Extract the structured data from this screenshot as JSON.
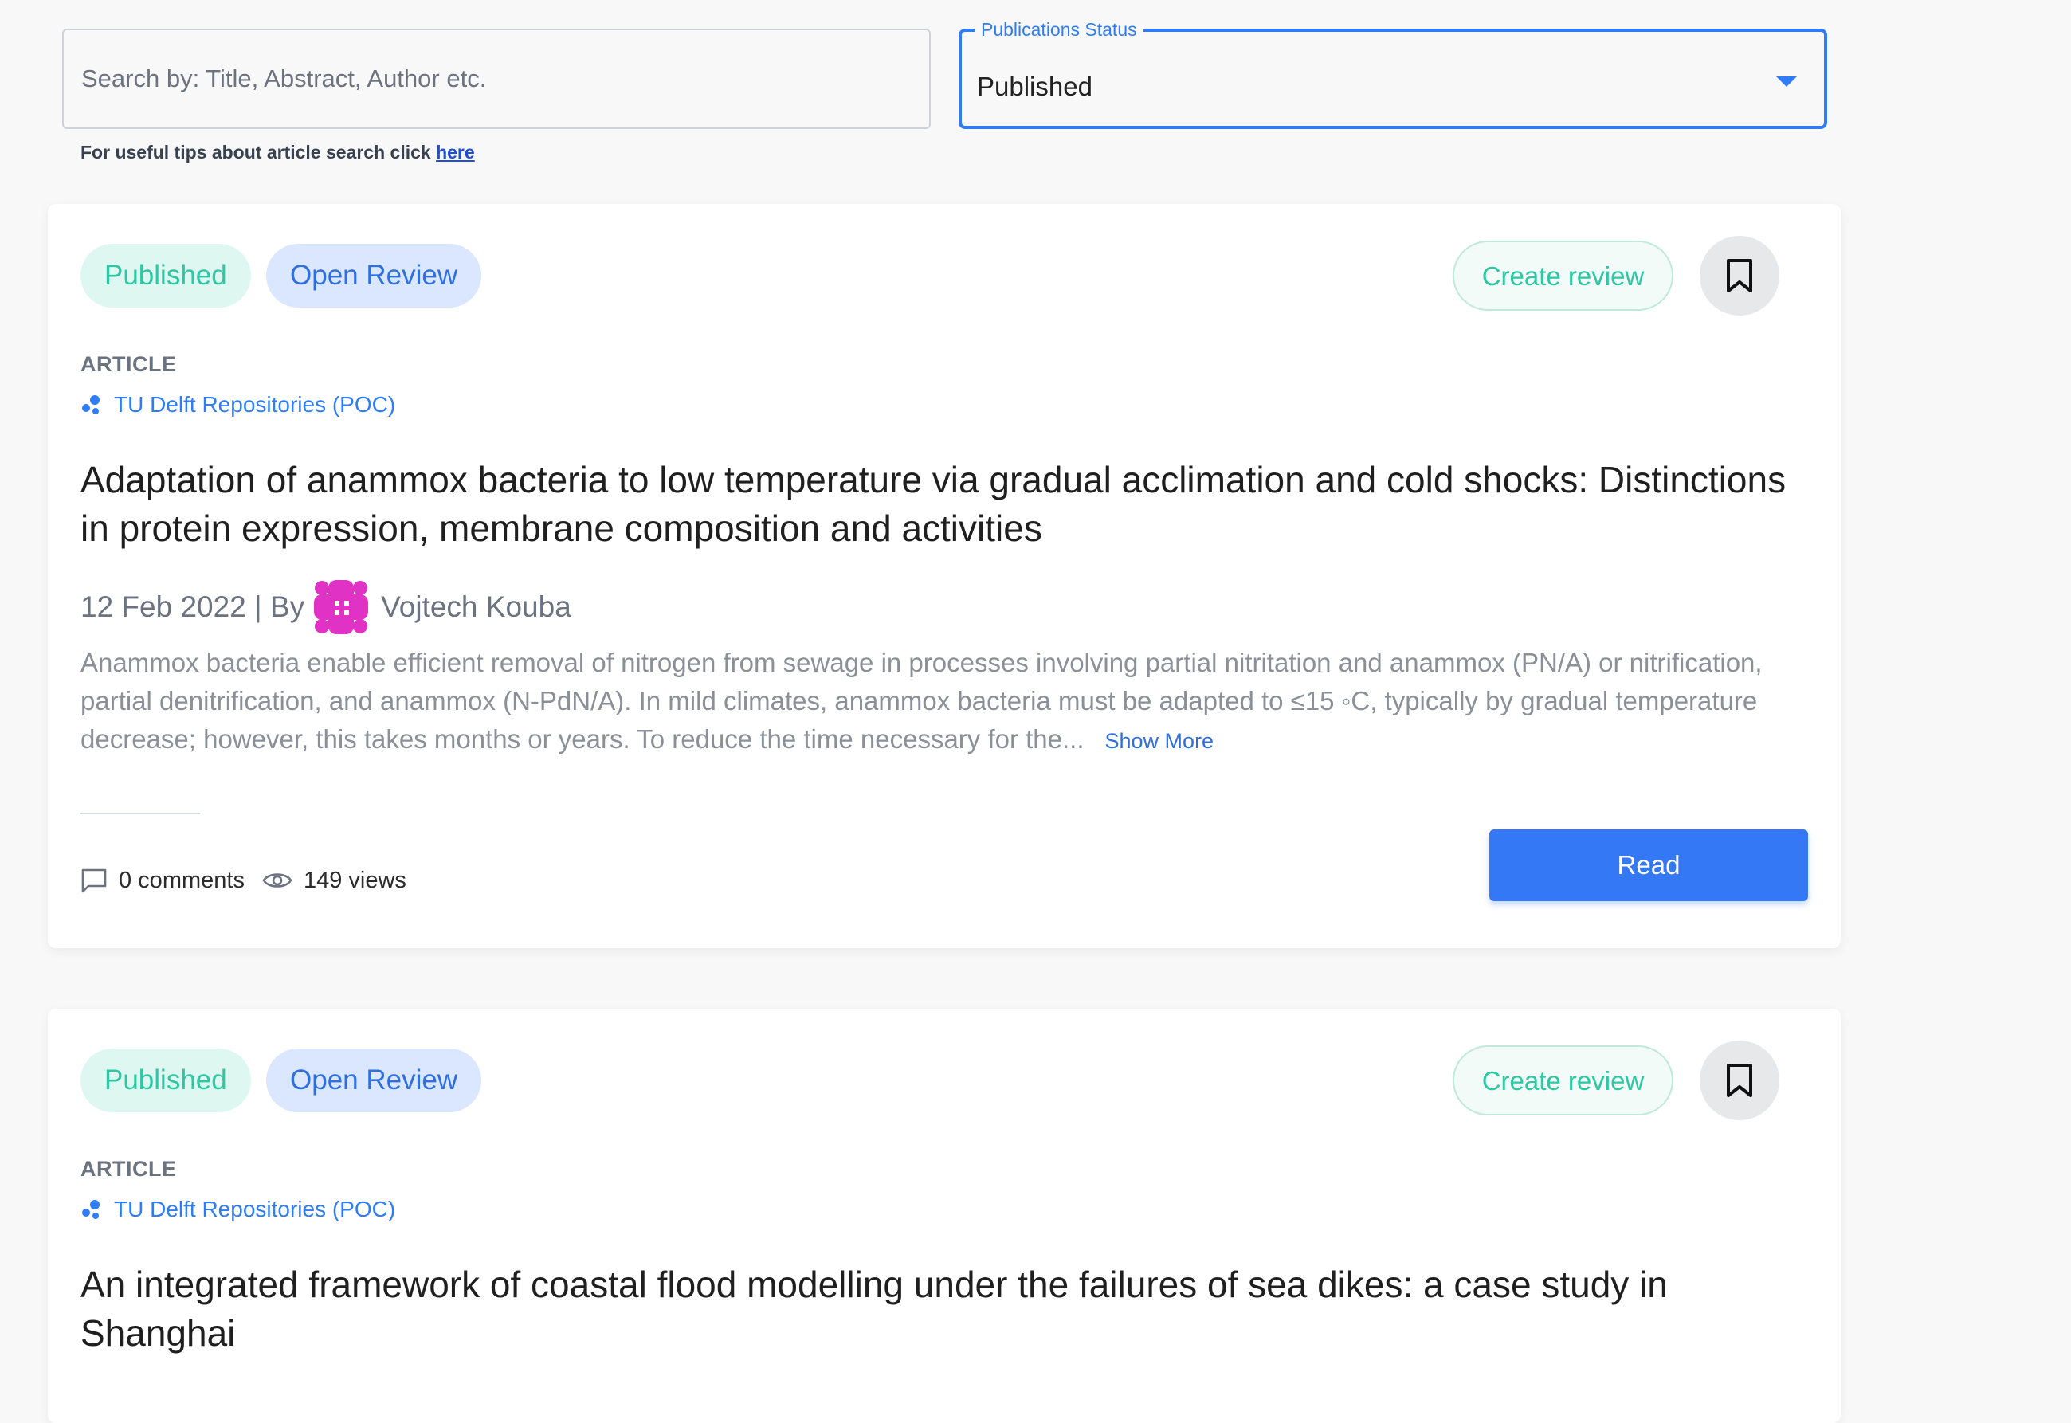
{
  "search": {
    "placeholder": "Search by: Title, Abstract, Author etc.",
    "tip_text": "For useful tips about article search click ",
    "tip_link": "here"
  },
  "status_filter": {
    "label": "Publications Status",
    "value": "Published"
  },
  "articles": [
    {
      "status_badge": "Published",
      "review_badge": "Open Review",
      "create_review_label": "Create review",
      "type": "ARTICLE",
      "source": "TU Delft Repositories (POC)",
      "title": "Adaptation of anammox bacteria to low temperature via gradual acclimation and cold shocks: Distinctions in protein expression, membrane composition and activities",
      "date_by": "12 Feb 2022 | By",
      "author": "Vojtech Kouba",
      "abstract": "Anammox bacteria enable efficient removal of nitrogen from sewage in processes involving partial nitritation and anammox (PN/A) or nitrification, partial denitrification, and anammox (N-PdN/A). In mild climates, anammox bacteria must be adapted to ≤15 ◦C, typically by gradual temperature decrease; however, this takes months or years. To reduce the time necessary for the...",
      "show_more": "Show More",
      "comments": "0 comments",
      "views": "149 views",
      "read_label": "Read"
    },
    {
      "status_badge": "Published",
      "review_badge": "Open Review",
      "create_review_label": "Create review",
      "type": "ARTICLE",
      "source": "TU Delft Repositories (POC)",
      "title": "An integrated framework of coastal flood modelling under the failures of sea dikes: a case study in Shanghai"
    }
  ],
  "colors": {
    "accent": "#3578f6",
    "published_text": "#2fc7a3",
    "published_bg": "#dff7f1",
    "open_review_text": "#2f6fde",
    "open_review_bg": "#dbe6ff",
    "avatar": "#e033c5"
  }
}
